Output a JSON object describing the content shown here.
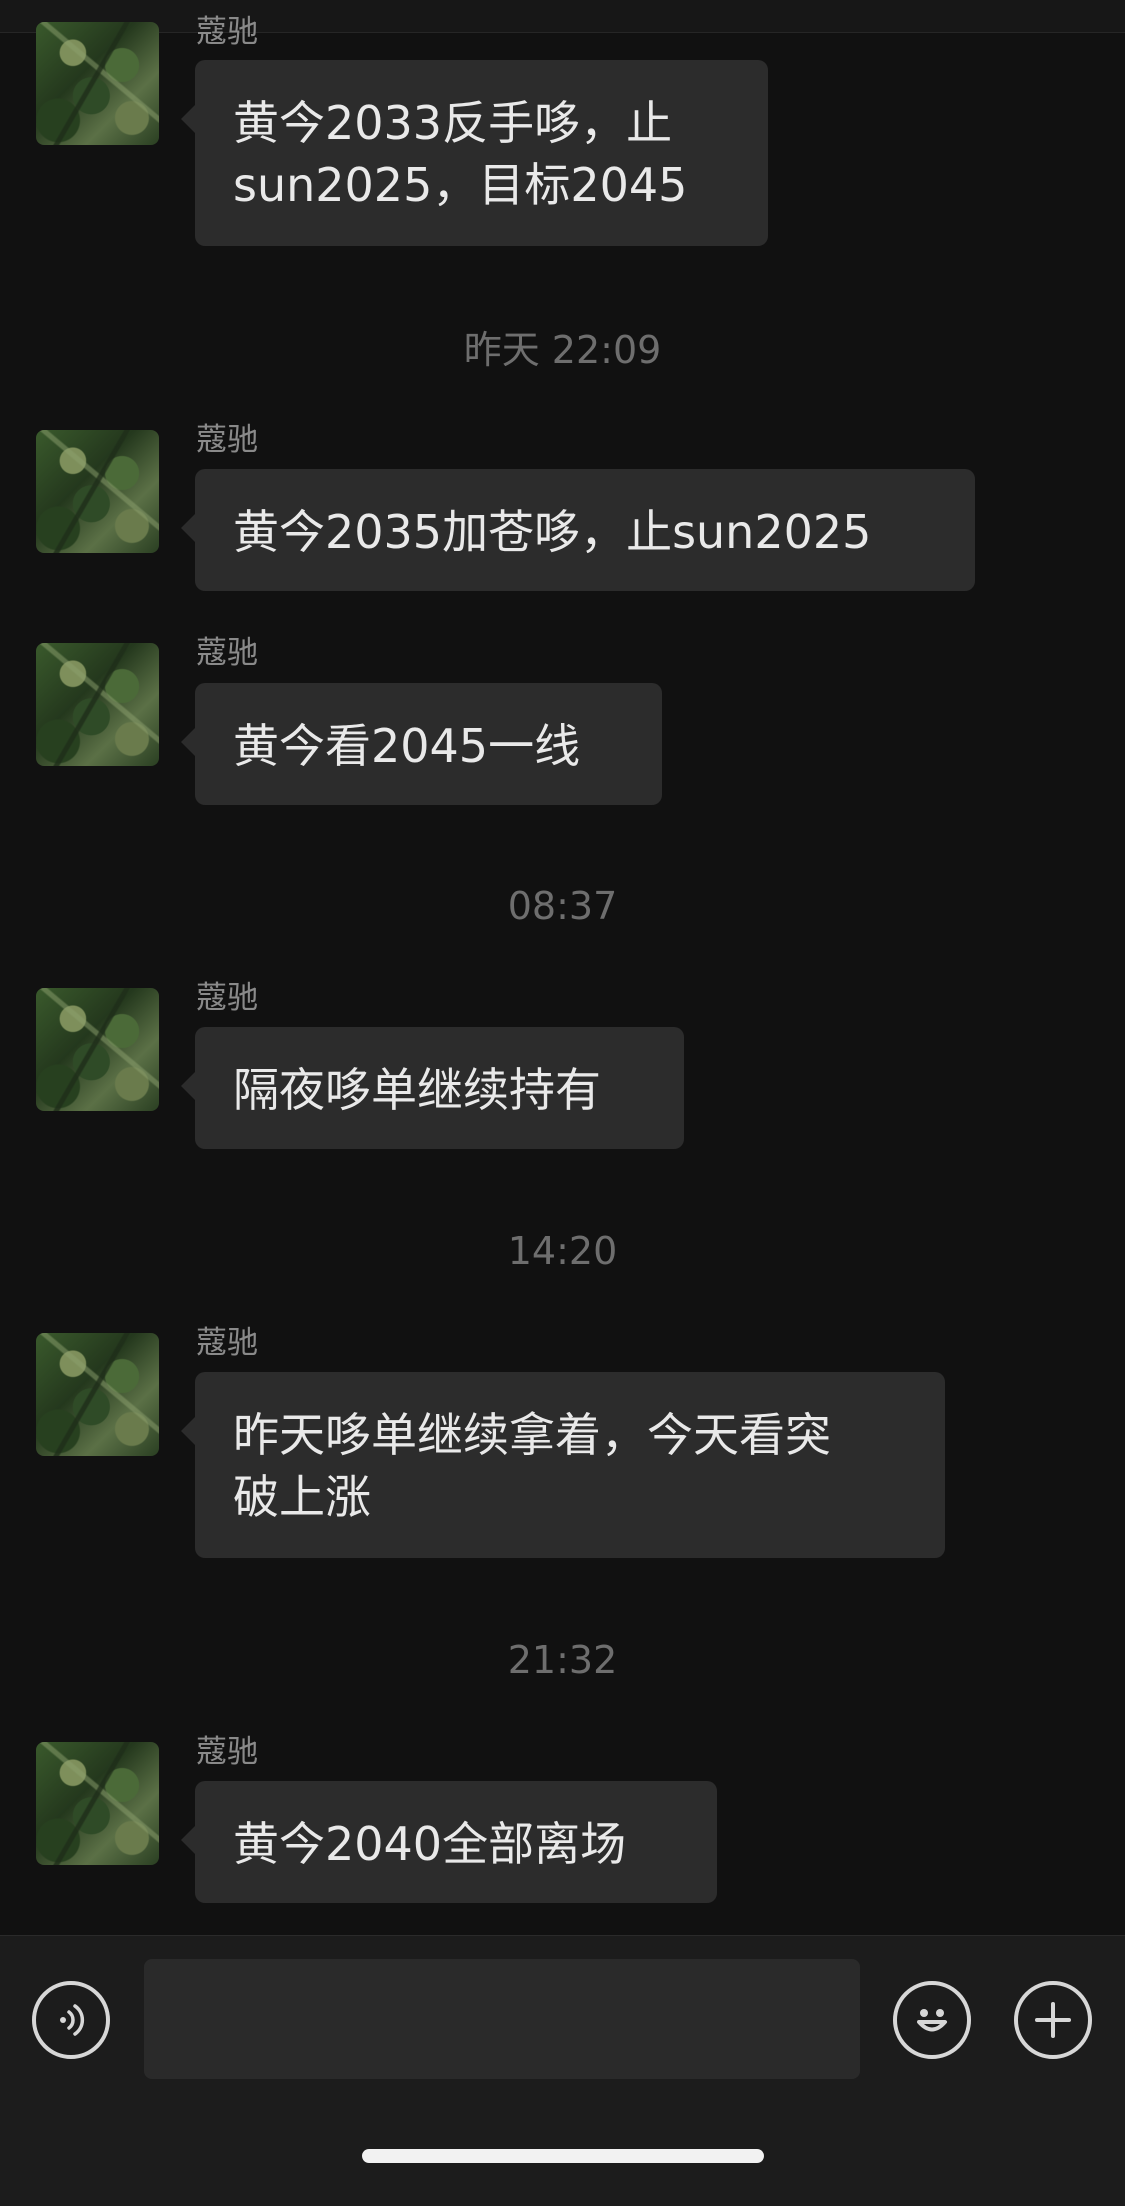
{
  "messages": [
    {
      "sender": "蔻驰",
      "lines": [
        "黄今2033反手哆，止",
        "sun2025，目标2045"
      ]
    },
    {
      "sender": "蔻驰",
      "lines": [
        "黄今2035加苍哆，止sun2025"
      ]
    },
    {
      "sender": "蔻驰",
      "lines": [
        "黄今看2045一线"
      ]
    },
    {
      "sender": "蔻驰",
      "lines": [
        "隔夜哆单继续持有"
      ]
    },
    {
      "sender": "蔻驰",
      "lines": [
        "昨天哆单继续拿着，今天看突",
        "破上涨"
      ]
    },
    {
      "sender": "蔻驰",
      "lines": [
        "黄今2040全部离场"
      ]
    }
  ],
  "timestamps": [
    "昨天 22:09",
    "08:37",
    "14:20",
    "21:32"
  ],
  "input": {
    "value": "",
    "placeholder": ""
  },
  "icons": {
    "voice": "voice-icon",
    "emoji": "emoji-icon",
    "plus": "plus-icon"
  }
}
